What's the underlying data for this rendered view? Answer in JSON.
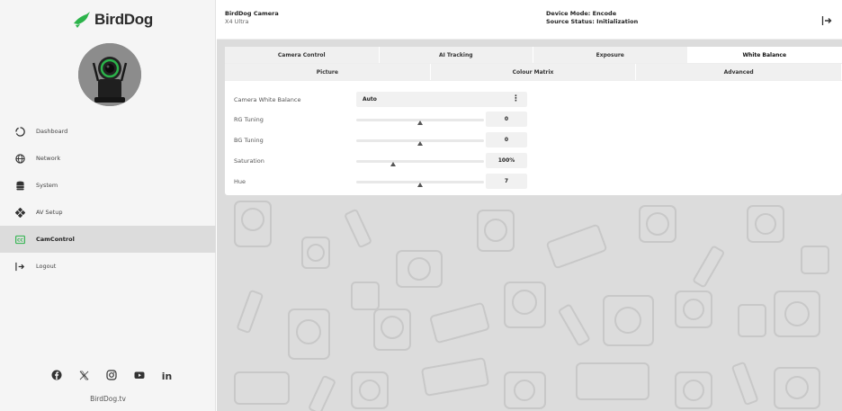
{
  "sidebar": {
    "logo_text": "BirdDog",
    "nav": [
      {
        "label": "Dashboard",
        "icon": "dashboard-icon",
        "active": false
      },
      {
        "label": "Network",
        "icon": "globe-icon",
        "active": false
      },
      {
        "label": "System",
        "icon": "database-icon",
        "active": false
      },
      {
        "label": "AV Setup",
        "icon": "av-setup-icon",
        "active": false
      },
      {
        "label": "CamControl",
        "icon": "camcontrol-icon",
        "active": true
      },
      {
        "label": "Logout",
        "icon": "logout-icon",
        "active": false
      }
    ],
    "social": [
      "facebook-icon",
      "x-icon",
      "instagram-icon",
      "youtube-icon",
      "linkedin-icon"
    ],
    "site": "BirdDog.tv"
  },
  "header": {
    "title": "BirdDog Camera",
    "subtitle": "X4 Ultra",
    "device_mode": "Device Mode: Encode",
    "source_status": "Source Status: Initialization"
  },
  "tabs": {
    "row1": [
      "Camera Control",
      "AI Tracking",
      "Exposure",
      "White Balance"
    ],
    "row2": [
      "Picture",
      "Colour Matrix",
      "Advanced"
    ],
    "active": "White Balance"
  },
  "white_balance": {
    "mode_label": "Camera White Balance",
    "mode_value": "Auto",
    "sliders": [
      {
        "label": "RG Tuning",
        "value": "0",
        "level": 0.5
      },
      {
        "label": "BG Tuning",
        "value": "0",
        "level": 0.5
      },
      {
        "label": "Saturation",
        "value": "100%",
        "level": 0.29
      },
      {
        "label": "Hue",
        "value": "7",
        "level": 0.5
      }
    ]
  },
  "colors": {
    "accent": "#2bb34a",
    "sidebar_bg": "#f5f5f5",
    "active_nav_bg": "#dcdcdc",
    "panel_bg": "#ffffff",
    "pattern_bg": "#dcdcdc"
  }
}
